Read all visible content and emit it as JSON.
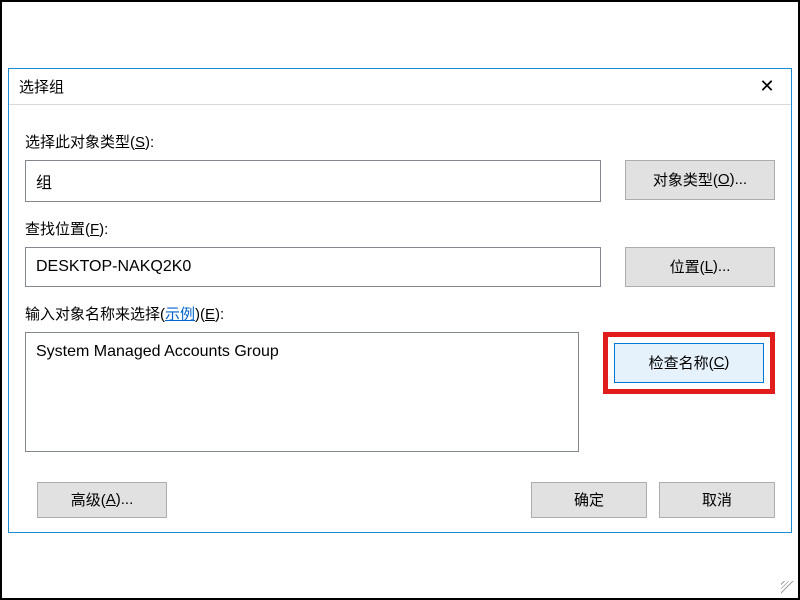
{
  "title": "选择组",
  "close_glyph": "✕",
  "section1": {
    "label_pre": "选择此对象类型(",
    "label_accel": "S",
    "label_post": "):",
    "value": "组",
    "button_pre": "对象类型(",
    "button_accel": "O",
    "button_post": ")..."
  },
  "section2": {
    "label_pre": "查找位置(",
    "label_accel": "F",
    "label_post": "):",
    "value": "DESKTOP-NAKQ2K0",
    "button_pre": "位置(",
    "button_accel": "L",
    "button_post": ")..."
  },
  "section3": {
    "label_pre": "输入对象名称来选择(",
    "example_text": "示例",
    "label_mid": ")(",
    "label_accel": "E",
    "label_post": "):",
    "value": "System Managed Accounts Group",
    "button_pre": "检查名称(",
    "button_accel": "C",
    "button_post": ")"
  },
  "footer": {
    "advanced_pre": "高级(",
    "advanced_accel": "A",
    "advanced_post": ")...",
    "ok": "确定",
    "cancel": "取消"
  }
}
